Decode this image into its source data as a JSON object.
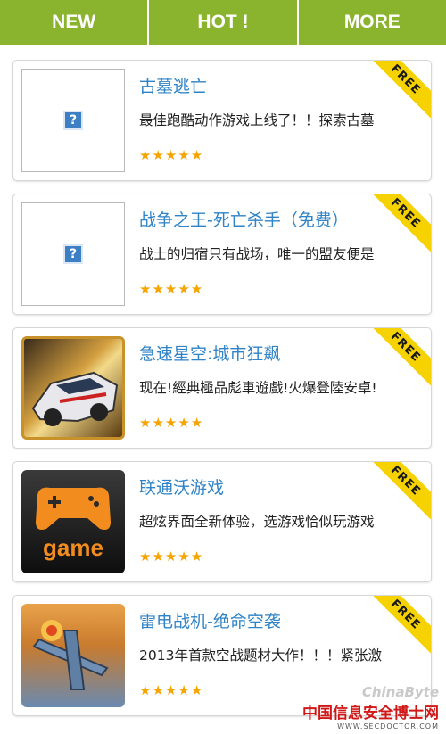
{
  "tabs": [
    "NEW",
    "HOT !",
    "MORE"
  ],
  "badge_text": "FREE",
  "apps": [
    {
      "title": "古墓逃亡",
      "desc": "最佳跑酷动作游戏上线了！！探索古墓",
      "rating": 5,
      "icon": "broken-image-icon"
    },
    {
      "title": "战争之王-死亡杀手（免费）",
      "desc": "战士的归宿只有战场，唯一的盟友便是",
      "rating": 5,
      "icon": "broken-image-icon"
    },
    {
      "title": "急速星空:城市狂飙",
      "desc": "现在!經典極品彪車遊戲!火爆登陸安卓!",
      "rating": 5,
      "icon": "race-car-icon"
    },
    {
      "title": "联通沃游戏",
      "desc": "超炫界面全新体验，选游戏恰似玩游戏",
      "rating": 5,
      "icon": "game-controller-icon"
    },
    {
      "title": "雷电战机-绝命空袭",
      "desc": "2013年首款空战题材大作！！！紧张激",
      "rating": 5,
      "icon": "fighter-plane-icon"
    }
  ],
  "watermark": {
    "top": "ChinaByte",
    "main": "中国信息安全博士网",
    "url": "WWW.SECDOCTOR.COM"
  },
  "colors": {
    "accent": "#8ab42e",
    "title": "#2f83c6",
    "star": "#f5a400",
    "badge": "#f6d200"
  }
}
